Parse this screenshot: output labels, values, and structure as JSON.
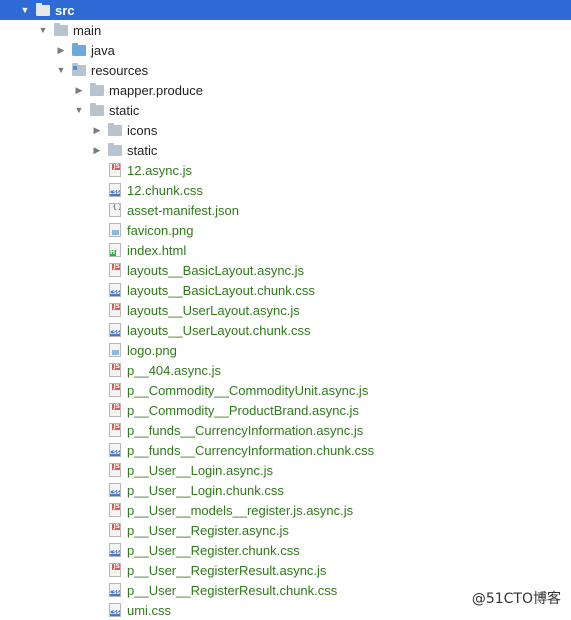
{
  "tree": [
    {
      "label": "src",
      "level": 0,
      "arrow": "down",
      "icon": "folder-white",
      "selected": true
    },
    {
      "label": "main",
      "level": 1,
      "arrow": "down",
      "icon": "folder-gray"
    },
    {
      "label": "java",
      "level": 2,
      "arrow": "right",
      "icon": "folder-blue"
    },
    {
      "label": "resources",
      "level": 2,
      "arrow": "down",
      "icon": "folder-resources"
    },
    {
      "label": "mapper.produce",
      "level": 3,
      "arrow": "right",
      "icon": "folder-gray"
    },
    {
      "label": "static",
      "level": 3,
      "arrow": "down",
      "icon": "folder-gray"
    },
    {
      "label": "icons",
      "level": 4,
      "arrow": "right",
      "icon": "folder-gray"
    },
    {
      "label": "static",
      "level": 4,
      "arrow": "right",
      "icon": "folder-gray"
    },
    {
      "label": "12.async.js",
      "level": 4,
      "icon": "js",
      "green": true
    },
    {
      "label": "12.chunk.css",
      "level": 4,
      "icon": "css",
      "green": true
    },
    {
      "label": "asset-manifest.json",
      "level": 4,
      "icon": "json",
      "green": true
    },
    {
      "label": "favicon.png",
      "level": 4,
      "icon": "image",
      "green": true
    },
    {
      "label": "index.html",
      "level": 4,
      "icon": "html",
      "green": true
    },
    {
      "label": "layouts__BasicLayout.async.js",
      "level": 4,
      "icon": "js",
      "green": true
    },
    {
      "label": "layouts__BasicLayout.chunk.css",
      "level": 4,
      "icon": "css",
      "green": true
    },
    {
      "label": "layouts__UserLayout.async.js",
      "level": 4,
      "icon": "js",
      "green": true
    },
    {
      "label": "layouts__UserLayout.chunk.css",
      "level": 4,
      "icon": "css",
      "green": true
    },
    {
      "label": "logo.png",
      "level": 4,
      "icon": "image",
      "green": true
    },
    {
      "label": "p__404.async.js",
      "level": 4,
      "icon": "js",
      "green": true
    },
    {
      "label": "p__Commodity__CommodityUnit.async.js",
      "level": 4,
      "icon": "js",
      "green": true
    },
    {
      "label": "p__Commodity__ProductBrand.async.js",
      "level": 4,
      "icon": "js",
      "green": true
    },
    {
      "label": "p__funds__CurrencyInformation.async.js",
      "level": 4,
      "icon": "js",
      "green": true
    },
    {
      "label": "p__funds__CurrencyInformation.chunk.css",
      "level": 4,
      "icon": "css",
      "green": true
    },
    {
      "label": "p__User__Login.async.js",
      "level": 4,
      "icon": "js",
      "green": true
    },
    {
      "label": "p__User__Login.chunk.css",
      "level": 4,
      "icon": "css",
      "green": true
    },
    {
      "label": "p__User__models__register.js.async.js",
      "level": 4,
      "icon": "js",
      "green": true
    },
    {
      "label": "p__User__Register.async.js",
      "level": 4,
      "icon": "js",
      "green": true
    },
    {
      "label": "p__User__Register.chunk.css",
      "level": 4,
      "icon": "css",
      "green": true
    },
    {
      "label": "p__User__RegisterResult.async.js",
      "level": 4,
      "icon": "js",
      "green": true
    },
    {
      "label": "p__User__RegisterResult.chunk.css",
      "level": 4,
      "icon": "css",
      "green": true
    },
    {
      "label": "umi.css",
      "level": 4,
      "icon": "css",
      "green": true
    }
  ],
  "icon_text": {
    "js": "JS",
    "css": "CSS",
    "html": "H",
    "binary": "10\n01\n010",
    "braces": "{}"
  },
  "watermark": "@51CTO博客",
  "colors": {
    "selection": "#2f6bd7",
    "file_text": "#2f7a1a",
    "folder_text": "#222222"
  }
}
